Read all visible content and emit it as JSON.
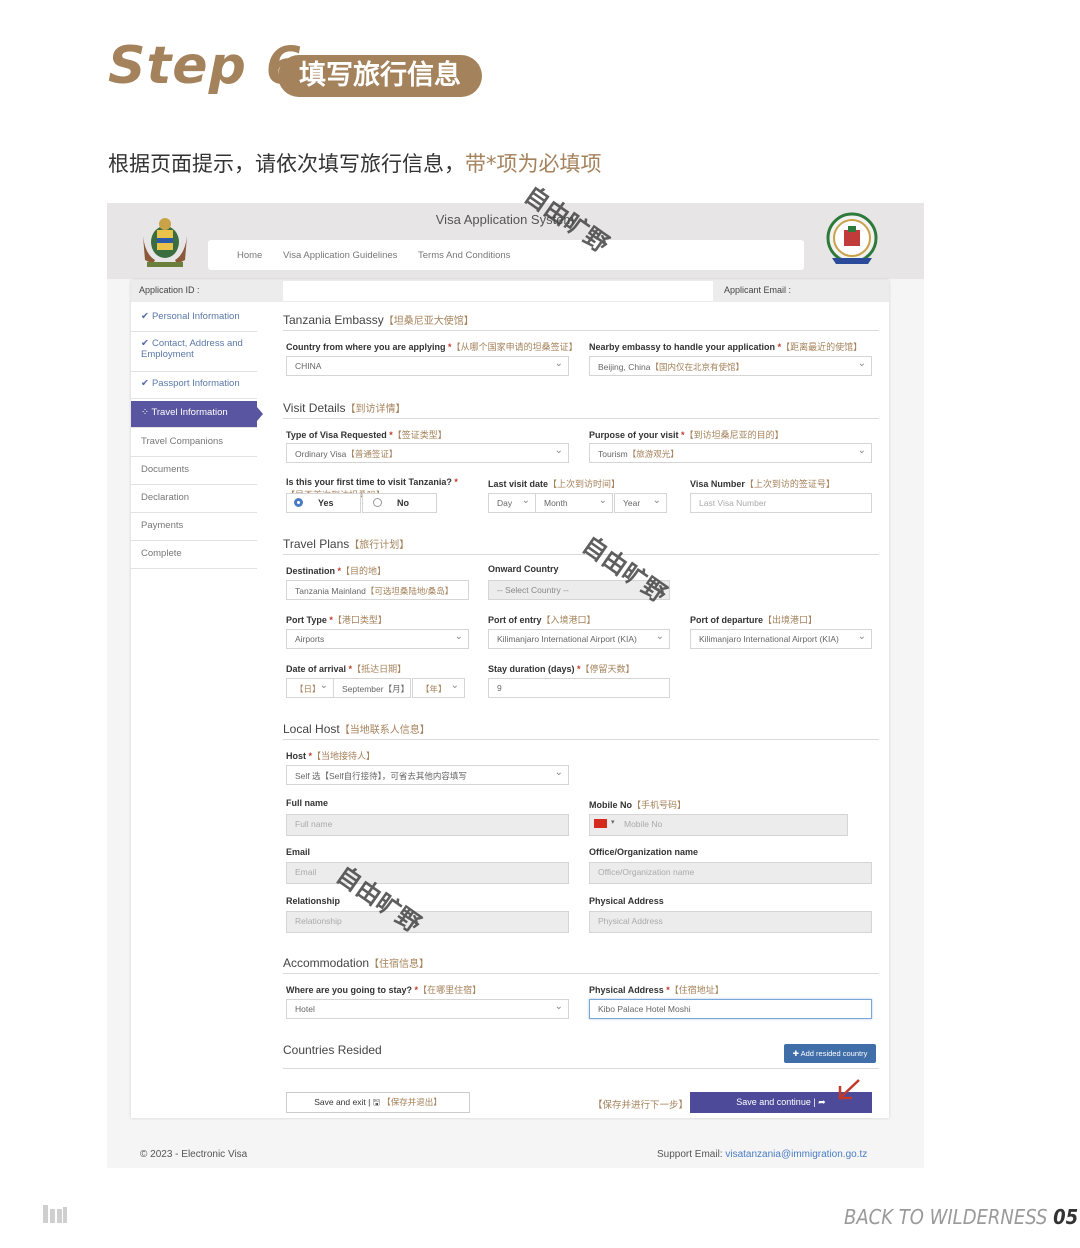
{
  "guide": {
    "step": "Step 6",
    "step_badge": "填写旅行信息",
    "intro_main": "根据页面提示，请依次填写旅行信息，",
    "intro_highlight": "带*项为必填项",
    "brand_prefix": "BACK TO WILDERNESS ",
    "brand_page": "05",
    "watermark": "自由旷野"
  },
  "app": {
    "title": "Visa Application System",
    "nav": [
      "Home",
      "Visa Application Guidelines",
      "Terms And Conditions"
    ],
    "application_id_label": "Application ID :",
    "applicant_email_label": "Applicant Email :"
  },
  "sidebar": {
    "items": [
      {
        "label": "Personal Information",
        "state": "done"
      },
      {
        "label": "Contact, Address and Employment",
        "state": "done"
      },
      {
        "label": "Passport Information",
        "state": "done"
      },
      {
        "label": "Travel Information",
        "state": "active"
      },
      {
        "label": "Travel Companions",
        "state": "pending"
      },
      {
        "label": "Documents",
        "state": "pending"
      },
      {
        "label": "Declaration",
        "state": "pending"
      },
      {
        "label": "Payments",
        "state": "pending"
      },
      {
        "label": "Complete",
        "state": "pending"
      }
    ]
  },
  "embassy": {
    "title": "Tanzania Embassy",
    "title_cn": "【坦桑尼亚大使馆】",
    "country_label": "Country from where you are applying",
    "country_cn": "【从哪个国家申请的坦桑签证】",
    "country_value": "CHINA",
    "nearby_label": "Nearby embassy to handle your application",
    "nearby_cn": "【距离最近的使馆】",
    "nearby_value": "Beijing, China",
    "nearby_value_cn": "【国内仅在北京有使馆】"
  },
  "visit": {
    "title": "Visit Details",
    "title_cn": "【到访详情】",
    "visa_type_label": "Type of Visa Requested",
    "visa_type_cn": "【签证类型】",
    "visa_type_value": "Ordinary Visa",
    "visa_type_value_cn": "【普通签证】",
    "purpose_label": "Purpose of your visit",
    "purpose_cn": "【到访坦桑尼亚的目的】",
    "purpose_value": "Tourism",
    "purpose_value_cn": "【旅游观光】",
    "first_time_label": "Is this your first time to visit Tanzania?",
    "first_time_cn": "【是否首次到访坦桑吗】",
    "yes": "Yes",
    "no": "No",
    "last_visit_label": "Last visit date",
    "last_visit_cn": "【上次到访时间】",
    "day": "Day",
    "month": "Month",
    "year": "Year",
    "visa_number_label": "Visa Number",
    "visa_number_cn": "【上次到访的签证号】",
    "visa_number_placeholder": "Last Visa Number"
  },
  "plans": {
    "title": "Travel Plans",
    "title_cn": "【旅行计划】",
    "destination_label": "Destination",
    "destination_cn": "【目的地】",
    "destination_value": "Tanzania Mainland",
    "destination_value_cn": "【可选坦桑陆地/桑岛】",
    "onward_label": "Onward Country",
    "onward_value": "-- Select Country --",
    "port_type_label": "Port Type",
    "port_type_cn": "【港口类型】",
    "port_type_value": "Airports",
    "entry_label": "Port of entry",
    "entry_cn": "【入境港口】",
    "entry_value": "Kilimanjaro International Airport (KIA)",
    "departure_label": "Port of departure",
    "departure_cn": "【出境港口】",
    "departure_value": "Kilimanjaro International Airport (KIA)",
    "arrival_label": "Date of arrival",
    "arrival_cn": "【抵达日期】",
    "arrival_day": "【日】",
    "arrival_month": "September【月】",
    "arrival_year": "【年】",
    "stay_label": "Stay duration (days)",
    "stay_cn": "【停留天数】",
    "stay_value": "9"
  },
  "host": {
    "title": "Local Host",
    "title_cn": "【当地联系人信息】",
    "host_label": "Host",
    "host_cn": "【当地接待人】",
    "host_value": "Self 选【Self自行接待】，可省去其他内容填写",
    "fullname_label": "Full name",
    "fullname_placeholder": "Full name",
    "mobile_label": "Mobile No",
    "mobile_cn": "【手机号码】",
    "mobile_placeholder": "Mobile No",
    "email_label": "Email",
    "email_placeholder": "Email",
    "office_label": "Office/Organization name",
    "office_placeholder": "Office/Organization name",
    "relationship_label": "Relationship",
    "relationship_placeholder": "Relationship",
    "address_label": "Physical Address",
    "address_placeholder": "Physical Address"
  },
  "accommodation": {
    "title": "Accommodation",
    "title_cn": "【住宿信息】",
    "stay_label": "Where are you going to stay?",
    "stay_cn": "【在哪里住宿】",
    "stay_value": "Hotel",
    "address_label": "Physical Address",
    "address_cn": "【住宿地址】",
    "address_value": "Kibo Palace Hotel Moshi"
  },
  "resided": {
    "title": "Countries Resided",
    "add_button": "Add resided country"
  },
  "actions": {
    "save_exit": "Save and exit |",
    "save_exit_cn": "【保存并退出】",
    "next_hint": "【保存并进行下一步】",
    "continue": "Save and continue |"
  },
  "footer": {
    "copyright": "© 2023 - Electronic Visa",
    "support": "Support Email: ",
    "support_email": "visatanzania@immigration.go.tz"
  },
  "colors": {
    "accent_brown": "#a4825b",
    "nav_active": "#5a55a0",
    "continue_button": "#4d4a99",
    "add_button": "#3f6ea8"
  }
}
